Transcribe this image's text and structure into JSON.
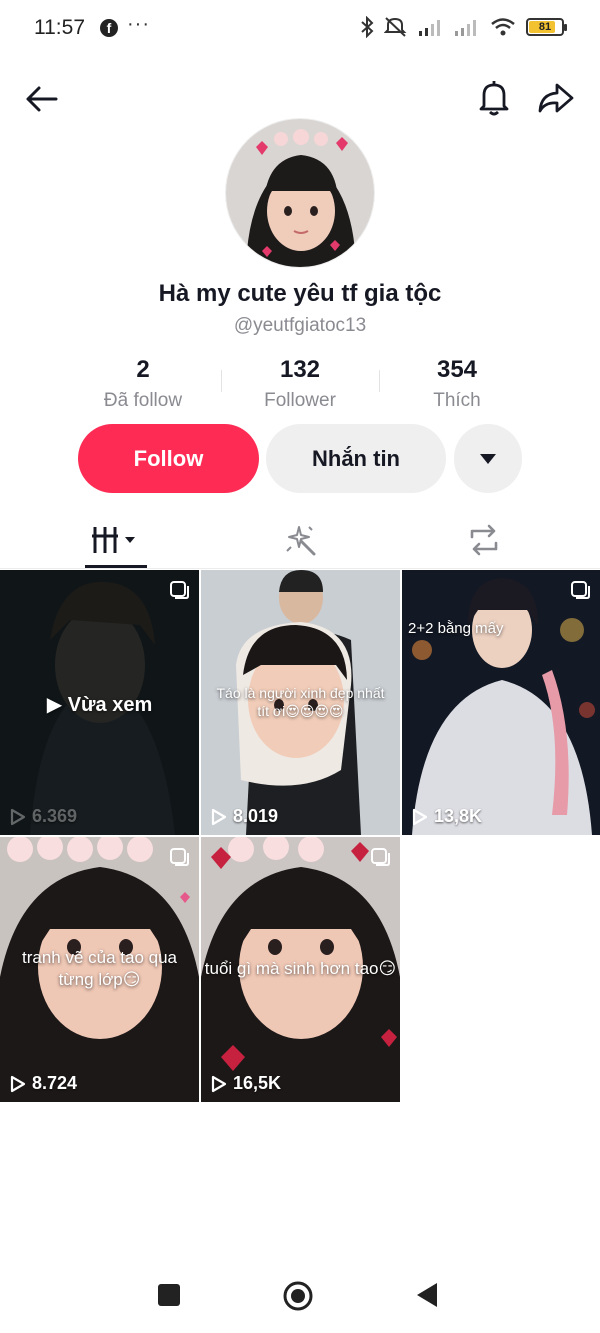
{
  "status_bar": {
    "time": "11:57",
    "app_icon": "facebook-icon",
    "more": "···",
    "battery": 81,
    "battery_label": "81",
    "icons": [
      "bluetooth-icon",
      "mute-icon",
      "signal-icon",
      "signal-icon",
      "wifi-icon",
      "battery-icon"
    ]
  },
  "top_nav": {
    "back_icon": "back-arrow-icon",
    "notification_icon": "bell-icon",
    "share_icon": "share-icon"
  },
  "profile": {
    "name": "Hà my cute yêu tf gia tộc",
    "handle": "@yeutfgiatoc13",
    "stats": [
      {
        "value": "2",
        "label": "Đã follow"
      },
      {
        "value": "132",
        "label": "Follower"
      },
      {
        "value": "354",
        "label": "Thích"
      }
    ]
  },
  "actions": {
    "follow_label": "Follow",
    "message_label": "Nhắn tin",
    "more_icon": "caret-down-icon"
  },
  "tabs": [
    {
      "icon": "videos-grid-icon",
      "active": true
    },
    {
      "icon": "sparkle-wand-icon",
      "active": false
    },
    {
      "icon": "repost-icon",
      "active": false
    }
  ],
  "videos": [
    {
      "views": "6.369",
      "overlay": "Vừa xem",
      "pinned": true
    },
    {
      "views": "8.019",
      "caption": "Táo là người xinh đẹp nhất tít ơi😍😍😍😍",
      "pinned": false
    },
    {
      "views": "13,8K",
      "caption": "2+2 bằng mấy",
      "pinned": true
    },
    {
      "views": "8.724",
      "caption": "tranh vẽ của tao qua từng lớp😏",
      "pinned": true
    },
    {
      "views": "16,5K",
      "caption": "tuổi gì mà sinh hơn tao😏",
      "pinned": true
    }
  ],
  "colors": {
    "accent": "#fe2c55",
    "secondary_button": "#efefef",
    "text_primary": "#161823",
    "text_secondary": "#8a8b91"
  },
  "system_nav": {
    "recents_icon": "square-icon",
    "home_icon": "home-circle-icon",
    "back_icon": "triangle-back-icon"
  }
}
